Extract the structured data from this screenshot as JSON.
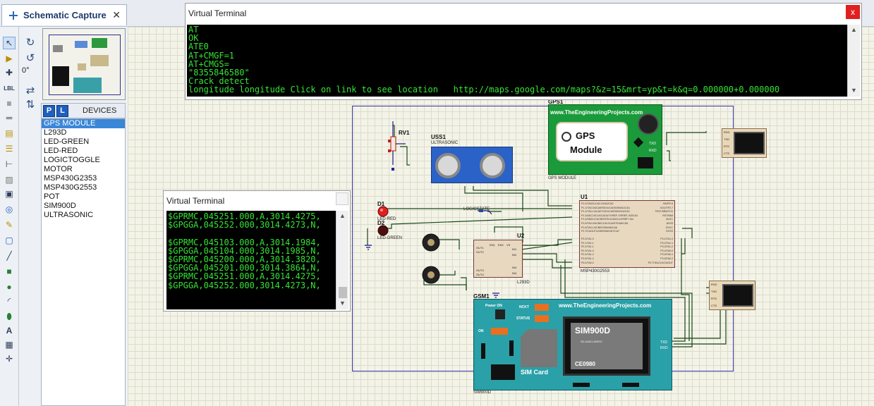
{
  "app": {
    "tab_title": "Schematic Capture",
    "tab_close": "✕",
    "rotation": "0°"
  },
  "devices": {
    "p_label": "P",
    "l_label": "L",
    "title": "DEVICES",
    "items": [
      "GPS MODULE",
      "L293D",
      "LED-GREEN",
      "LED-RED",
      "LOGICTOGGLE",
      "MOTOR",
      "MSP430G2353",
      "MSP430G2553",
      "POT",
      "SIM900D",
      "ULTRASONIC"
    ],
    "selected": "GPS MODULE"
  },
  "terminal_top": {
    "title": "Virtual Terminal",
    "close": "x",
    "lines": [
      "AT",
      "OK",
      "ATE0",
      "AT+CMGF=1",
      "AT+CMGS=",
      "\"8355846580\"",
      "Crack detect",
      "longitude longitude Click on link to see location   http://maps.google.com/maps?&z=15&mrt=yp&t=k&q=0.000000+0.000000"
    ]
  },
  "terminal_left": {
    "title": "Virtual Terminal",
    "lines": [
      "$GPRMC,045251.000,A,3014.4275,",
      "$GPGGA,045252.000,3014.4273,N,",
      "",
      "$GPRMC,045103.000,A,3014.1984,",
      "$GPGGA,045104.000,3014.1985,N,",
      "$GPRMC,045200.000,A,3014.3820,",
      "$GPGGA,045201.000,3014.3864,N,",
      "$GPRMC,045251.000,A,3014.4275,",
      "$GPGGA,045252.000,3014.4273,N,"
    ]
  },
  "schematic": {
    "gps_ref": "GPS1",
    "gps_site": "www.TheEngineeringProjects.com",
    "gps_line1": "GPS",
    "gps_line2": "Module",
    "gps_sub": "GPS MODULE",
    "uss_ref": "USS1",
    "uss_sub": "ULTRASONIC",
    "rv_ref": "RV1",
    "d1_ref": "D1",
    "d2_ref": "D2",
    "led_red": "LED-RED",
    "led_green": "LED-GREEN",
    "u1_ref": "U1",
    "u1_sub": "MSP430G2553",
    "u2_ref": "U2",
    "u2_sub": "L293D",
    "gsm_ref": "GSM1",
    "gsm_site": "www.TheEngineeringProjects.com",
    "gsm_chip": "SIM900D",
    "gsm_chip_sub": "S2-1041Y-Z097C",
    "gsm_ce": "CE0980",
    "gsm_simcard": "SIM Card",
    "gsm_power": "Power ON",
    "gsm_nckt": "NCKT",
    "gsm_status": "STATUS",
    "gsm_on": "ON",
    "gsm_sub": "SIM900D",
    "tx": "TXD",
    "rx": "RXD",
    "rxd_pin": "RXD",
    "txd_pin": "TXD",
    "rts_pin": "RTS",
    "cts_pin": "CTS",
    "vt_small_pins": [
      "RXD",
      "TXD",
      "RTS",
      "CTS"
    ],
    "u1_left_pins": [
      "P1.0/TA0CLK/ACLK/A0/CA0",
      "P1.1/TA0.0/UCA0RXD/UCA0SOMI/A1/CA1",
      "P1.2/TA0.1/UCA0TXD/UCA0SIMO/A2/CA2",
      "P1.3/ADC10CLK/CAOUT/VREF-/VEREF-/A3/CA3",
      "P1.4/SMCLK/UCB0STE/UCA0CLK/VREF+/A4",
      "P1.5/TA0.0/UCB0CLK/UCA0STE/A5/CA5",
      "P1.6/TA0.1/UCB0SOMI/A6/CA6",
      "P1.7/CAOUT/UCB0SIMO/A7/CA7"
    ],
    "u1_right_pins": [
      "XIN/P2.6",
      "XOUT/P2.7",
      "TEST/SBWTCK",
      "RST/NMI",
      "AVCC",
      "AVSS",
      "DVCC",
      "DVSS"
    ],
    "u1_left_pins2": [
      "P2.0/TA1.0",
      "P2.1/TA1.1",
      "P2.2/TA1.1",
      "P2.3/TA1.0",
      "P2.4/TA1.2",
      "P2.5/TA1.2",
      "P3.0/TA0.2"
    ],
    "u1_right_pins2": [
      "P3.1/TA1.0",
      "P3.2/TA1.1",
      "P3.3/TA1.2",
      "P3.4/TA0.0",
      "P3.5/TA0.1",
      "P3.6/TA0.2",
      "P3.7/TA1CLK/CAOUT"
    ],
    "u2_pins_left": [
      "OUT1",
      "OUT2",
      "OUT3",
      "OUT4"
    ],
    "u2_pins_right": [
      "IN1",
      "IN2",
      "IN3",
      "IN4"
    ],
    "u2_top": [
      "EN1",
      "EN2",
      "VS",
      "VSS"
    ],
    "logic_label": "LOGICSTATE"
  }
}
